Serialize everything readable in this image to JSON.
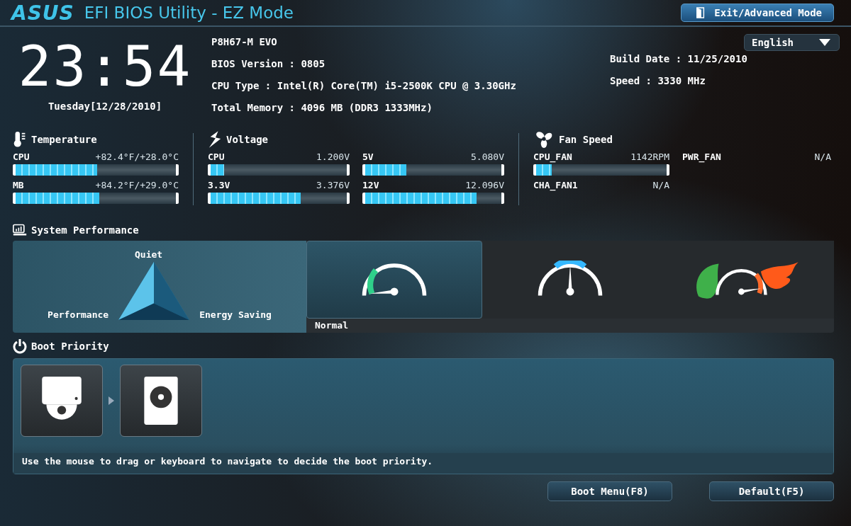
{
  "header": {
    "logo": "ASUS",
    "title": "EFI BIOS Utility - EZ Mode",
    "exit_button": "Exit/Advanced Mode"
  },
  "clock": {
    "time": "23:54",
    "date": "Tuesday[12/28/2010]"
  },
  "system_info": {
    "left": [
      "P8H67-M EVO",
      "BIOS Version : 0805",
      "CPU Type : Intel(R) Core(TM) i5-2500K CPU @ 3.30GHz",
      "Total Memory : 4096 MB (DDR3 1333MHz)"
    ],
    "right": [
      "Build Date : 11/25/2010",
      "Speed : 3330 MHz"
    ],
    "language": "English"
  },
  "temperature": {
    "title": "Temperature",
    "items": [
      {
        "name": "CPU",
        "reading": "+82.4°F/+28.0°C",
        "level": 0.51
      },
      {
        "name": "MB",
        "reading": "+84.2°F/+29.0°C",
        "level": 0.52
      }
    ]
  },
  "voltage": {
    "title": "Voltage",
    "items": [
      {
        "name": "CPU",
        "reading": "1.200V",
        "level": 0.1
      },
      {
        "name": "5V",
        "reading": "5.080V",
        "level": 0.3
      },
      {
        "name": "3.3V",
        "reading": "3.376V",
        "level": 0.66
      },
      {
        "name": "12V",
        "reading": "12.096V",
        "level": 0.82
      }
    ]
  },
  "fan_speed": {
    "title": "Fan Speed",
    "items": [
      {
        "name": "CPU_FAN",
        "reading": "1142RPM",
        "kind": "bar",
        "level": 0.12
      },
      {
        "name": "PWR_FAN",
        "reading": "N/A",
        "kind": "text"
      },
      {
        "name": "CHA_FAN1",
        "reading": "N/A",
        "kind": "text"
      }
    ]
  },
  "system_performance": {
    "title": "System Performance",
    "triangle": {
      "top": "Quiet",
      "left": "Performance",
      "right": "Energy Saving"
    },
    "modes": [
      {
        "kind": "normal",
        "selected": true,
        "caption": "Normal"
      },
      {
        "kind": "quiet",
        "selected": false
      },
      {
        "kind": "performance",
        "selected": false
      }
    ]
  },
  "boot_priority": {
    "title": "Boot Priority",
    "devices": [
      {
        "kind": "optical"
      },
      {
        "kind": "disk"
      }
    ],
    "hint": "Use the mouse to drag or keyboard to navigate to decide the boot priority."
  },
  "buttons": [
    "Boot Menu(F8)",
    "Default(F5)"
  ]
}
